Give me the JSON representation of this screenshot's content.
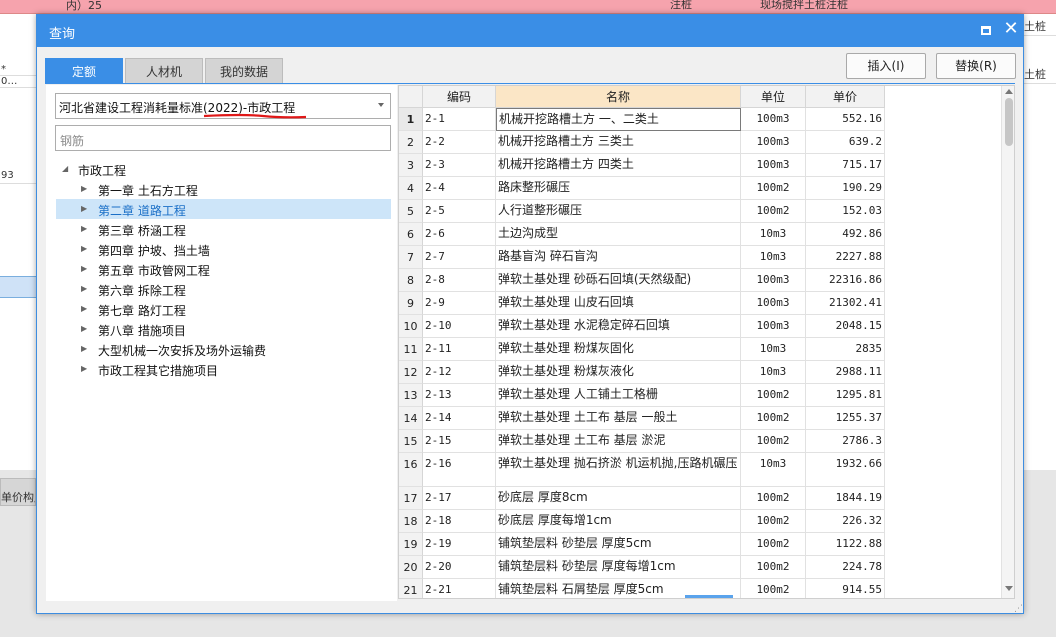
{
  "background": {
    "top_row": {
      "left_text": "内）25",
      "right_text1": "注桩",
      "right_text2": "现场搅拌土桩注桩"
    },
    "left_col": [
      "*",
      "0…",
      "93"
    ],
    "right_col": [
      "土桩",
      "土桩"
    ],
    "bottom_tab": "单价构成"
  },
  "dialog": {
    "title": "查询",
    "tabs": [
      "定额",
      "人材机",
      "我的数据"
    ],
    "buttons": {
      "insert": "插入(I)",
      "replace": "替换(R)"
    }
  },
  "left_panel": {
    "combo_value": "河北省建设工程消耗量标准(2022)-市政工程",
    "search_placeholder": "钢筋",
    "tree": {
      "root": "市政工程",
      "items": [
        "第一章 土石方工程",
        "第二章 道路工程",
        "第三章 桥涵工程",
        "第四章 护坡、挡土墙",
        "第五章 市政管网工程",
        "第六章 拆除工程",
        "第七章 路灯工程",
        "第八章 措施项目",
        "大型机械一次安拆及场外运输费",
        "市政工程其它措施项目"
      ],
      "selected_index": 1
    }
  },
  "grid": {
    "headers": {
      "code": "编码",
      "name": "名称",
      "unit": "单位",
      "price": "单价"
    },
    "rows": [
      {
        "n": "1",
        "code": "2-1",
        "name": "机械开挖路槽土方 一、二类土",
        "unit": "100m3",
        "price": "552.16"
      },
      {
        "n": "2",
        "code": "2-2",
        "name": "机械开挖路槽土方 三类土",
        "unit": "100m3",
        "price": "639.2"
      },
      {
        "n": "3",
        "code": "2-3",
        "name": "机械开挖路槽土方 四类土",
        "unit": "100m3",
        "price": "715.17"
      },
      {
        "n": "4",
        "code": "2-4",
        "name": "路床整形碾压",
        "unit": "100m2",
        "price": "190.29"
      },
      {
        "n": "5",
        "code": "2-5",
        "name": "人行道整形碾压",
        "unit": "100m2",
        "price": "152.03"
      },
      {
        "n": "6",
        "code": "2-6",
        "name": "土边沟成型",
        "unit": "10m3",
        "price": "492.86"
      },
      {
        "n": "7",
        "code": "2-7",
        "name": "路基盲沟 碎石盲沟",
        "unit": "10m3",
        "price": "2227.88"
      },
      {
        "n": "8",
        "code": "2-8",
        "name": "弹软土基处理 砂砾石回填(天然级配)",
        "unit": "100m3",
        "price": "22316.86"
      },
      {
        "n": "9",
        "code": "2-9",
        "name": "弹软土基处理 山皮石回填",
        "unit": "100m3",
        "price": "21302.41"
      },
      {
        "n": "10",
        "code": "2-10",
        "name": "弹软土基处理 水泥稳定碎石回填",
        "unit": "100m3",
        "price": "2048.15"
      },
      {
        "n": "11",
        "code": "2-11",
        "name": "弹软土基处理 粉煤灰固化",
        "unit": "10m3",
        "price": "2835"
      },
      {
        "n": "12",
        "code": "2-12",
        "name": "弹软土基处理 粉煤灰液化",
        "unit": "10m3",
        "price": "2988.11"
      },
      {
        "n": "13",
        "code": "2-13",
        "name": "弹软土基处理 人工铺土工格栅",
        "unit": "100m2",
        "price": "1295.81"
      },
      {
        "n": "14",
        "code": "2-14",
        "name": "弹软土基处理 土工布 基层 一般土",
        "unit": "100m2",
        "price": "1255.37"
      },
      {
        "n": "15",
        "code": "2-15",
        "name": "弹软土基处理 土工布 基层 淤泥",
        "unit": "100m2",
        "price": "2786.3"
      },
      {
        "n": "16",
        "code": "2-16",
        "name": "弹软土基处理 抛石挤淤 机运机抛,压路机碾压",
        "unit": "10m3",
        "price": "1932.66"
      },
      {
        "n": "17",
        "code": "2-17",
        "name": "砂底层 厚度8cm",
        "unit": "100m2",
        "price": "1844.19"
      },
      {
        "n": "18",
        "code": "2-18",
        "name": "砂底层 厚度每增1cm",
        "unit": "100m2",
        "price": "226.32"
      },
      {
        "n": "19",
        "code": "2-19",
        "name": "铺筑垫层料 砂垫层 厚度5cm",
        "unit": "100m2",
        "price": "1122.88"
      },
      {
        "n": "20",
        "code": "2-20",
        "name": "铺筑垫层料 砂垫层 厚度每增1cm",
        "unit": "100m2",
        "price": "224.78"
      },
      {
        "n": "21",
        "code": "2-21",
        "name": "铺筑垫层料 石屑垫层 厚度5cm",
        "unit": "100m2",
        "price": "914.55"
      }
    ]
  }
}
